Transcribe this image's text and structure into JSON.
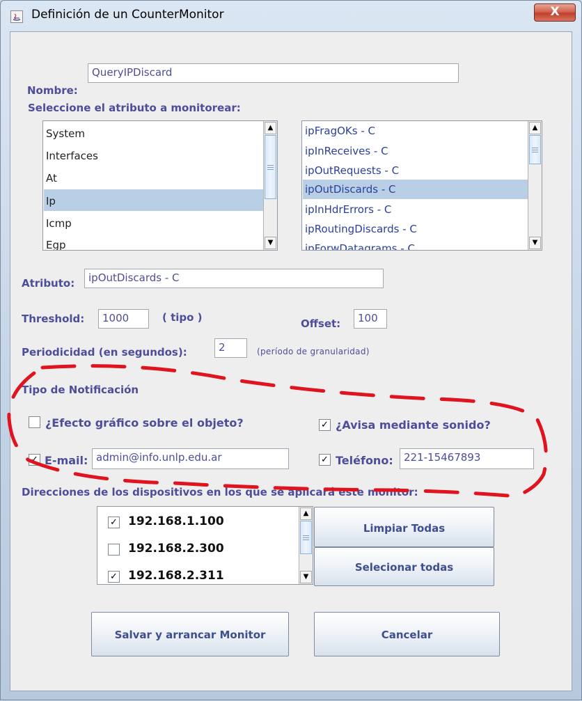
{
  "window": {
    "title": "Definición de un CounterMonitor",
    "close_label": "X"
  },
  "nombre": {
    "label": "Nombre:",
    "value": "QueryIPDiscard"
  },
  "seleccione_label": "Seleccione el atributo a monitorear:",
  "groups_list": {
    "items": [
      "System",
      "Interfaces",
      "At",
      "Ip",
      "Icmp",
      "Egp"
    ],
    "selected": "Ip"
  },
  "attributes_list": {
    "items": [
      "ipFragOKs - C",
      "ipInReceives - C",
      "ipOutRequests - C",
      "ipOutDiscards - C",
      "ipInHdrErrors - C",
      "ipRoutingDiscards - C",
      "ipForwDatagrams - C"
    ],
    "selected": "ipOutDiscards - C"
  },
  "atributo": {
    "label": "Atributo:",
    "value": "ipOutDiscards - C"
  },
  "threshold": {
    "label": "Threshold:",
    "value": "1000",
    "tipo": "( tipo )"
  },
  "offset": {
    "label": "Offset:",
    "value": "100"
  },
  "periodicidad": {
    "label": "Periodicidad (en segundos):",
    "value": "2",
    "hint": "(período de granularidad)"
  },
  "notificacion": {
    "section_label": "Tipo de Notificación",
    "efecto": {
      "label": "¿Efecto gráfico sobre el objeto?",
      "checked": false
    },
    "sonido": {
      "label": "¿Avisa mediante sonido?",
      "checked": true
    },
    "email": {
      "label": "E-mail:",
      "value": "admin@info.unlp.edu.ar",
      "checked": true
    },
    "telefono": {
      "label": "Teléfono:",
      "value": "221-15467893",
      "checked": true
    }
  },
  "direcciones": {
    "label": "Direcciones de los dispositivos en los que se aplicará este monitor:",
    "items": [
      {
        "ip": "192.168.1.100",
        "checked": true
      },
      {
        "ip": "192.168.2.300",
        "checked": false
      },
      {
        "ip": "192.168.2.311",
        "checked": true
      }
    ]
  },
  "buttons": {
    "limpiar": "Limpiar Todas",
    "seleccionar": "Selecionar todas",
    "salvar": "Salvar y arrancar Monitor",
    "cancelar": "Cancelar"
  },
  "check_glyph": "✓",
  "annotation_color": "#e0141e"
}
